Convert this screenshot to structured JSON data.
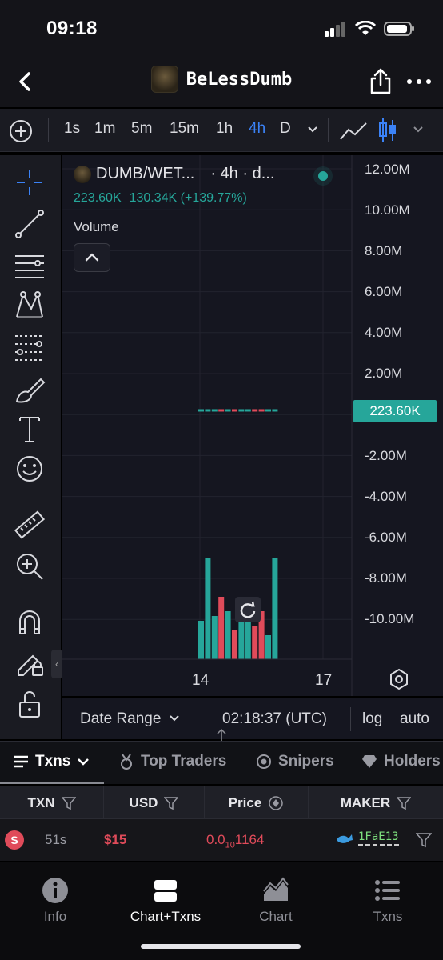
{
  "status": {
    "time": "09:18"
  },
  "header": {
    "token_name": "BeLessDumb"
  },
  "toolbar": {
    "intervals": [
      "1s",
      "1m",
      "5m",
      "15m",
      "1h",
      "4h",
      "D"
    ],
    "active_interval": "4h"
  },
  "chart": {
    "legend_symbol": "DUMB/WET...",
    "legend_meta": "· 4h · d...",
    "legend_value": "223.60K",
    "legend_change": "130.34K (+139.77%)",
    "volume_label": "Volume",
    "current_price_tag": "223.60K",
    "y_tick_labels": [
      "12.00M",
      "10.00M",
      "8.00M",
      "6.00M",
      "4.00M",
      "2.00M",
      "-2.00M",
      "-4.00M",
      "-6.00M",
      "-8.00M",
      "-10.00M"
    ],
    "x_tick_labels": [
      "14",
      "17"
    ]
  },
  "chart_data": {
    "type": "bar",
    "title": "",
    "series": [
      {
        "name": "Volume",
        "values": [
          0.8,
          2.1,
          0.9,
          1.3,
          1.0,
          0.6,
          0.9,
          1.2,
          0.7,
          1.0,
          0.5,
          2.1
        ]
      }
    ],
    "colors": [
      "#26a69a",
      "#26a69a",
      "#26a69a",
      "#e04b5a",
      "#26a69a",
      "#e04b5a",
      "#26a69a",
      "#26a69a",
      "#e04b5a",
      "#e04b5a",
      "#26a69a",
      "#26a69a"
    ],
    "ylim": [
      -12,
      12
    ],
    "price_line": 0.2236,
    "grid": true
  },
  "date_bar": {
    "date_range": "Date Range",
    "utc_time": "02:18:37 (UTC)",
    "log": "log",
    "auto": "auto"
  },
  "tabs": [
    {
      "label": "Txns",
      "active": true
    },
    {
      "label": "Top Traders"
    },
    {
      "label": "Snipers"
    },
    {
      "label": "Holders"
    }
  ],
  "table": {
    "headers": [
      "TXN",
      "USD",
      "Price",
      "MAKER"
    ],
    "rows": [
      {
        "side": "S",
        "age": "51s",
        "usd": "$15",
        "price_prefix": "0.0",
        "price_sub": "10",
        "price_rest": "1164",
        "maker": "1FaE13"
      }
    ]
  },
  "bottom_nav": [
    {
      "label": "Info"
    },
    {
      "label": "Chart+Txns",
      "active": true
    },
    {
      "label": "Chart"
    },
    {
      "label": "Txns"
    }
  ],
  "colors": {
    "up": "#26a69a",
    "down": "#e04b5a",
    "accent": "#3b82f6"
  }
}
